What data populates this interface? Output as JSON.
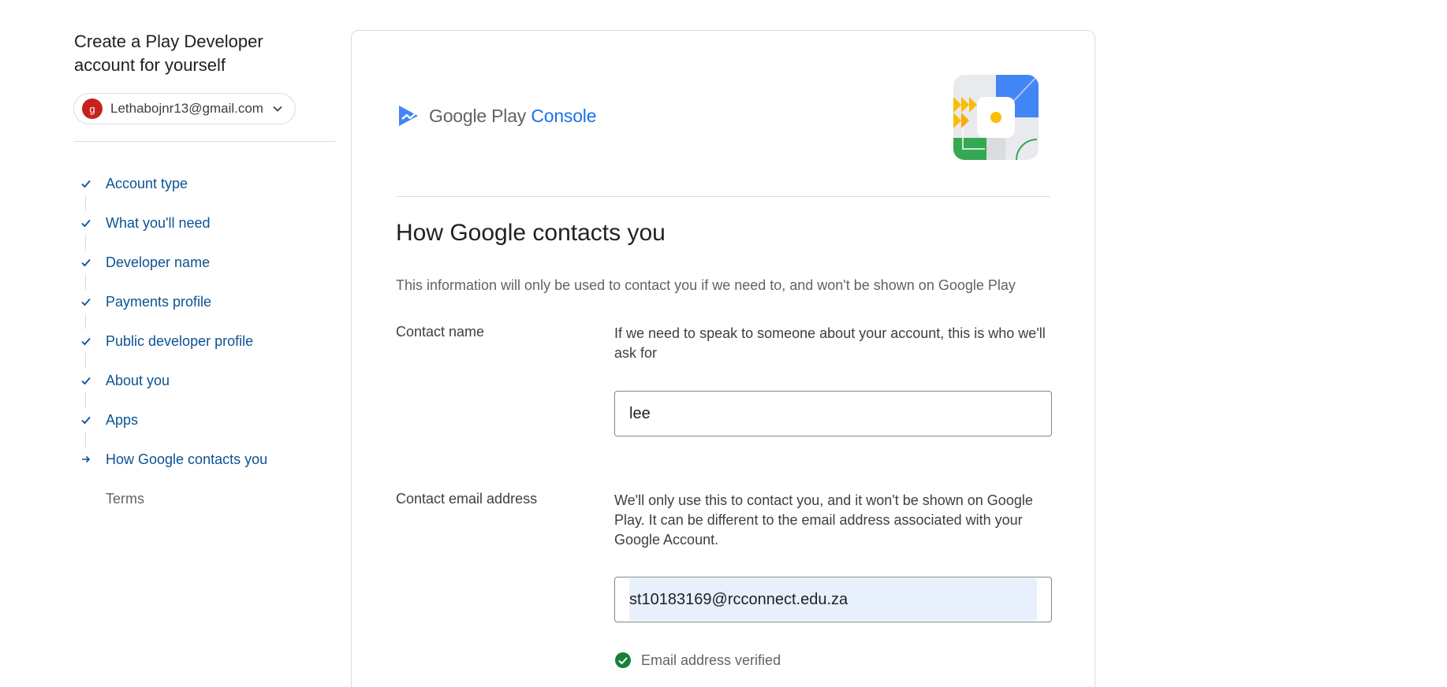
{
  "sidebar": {
    "heading": "Create a Play Developer account for yourself",
    "account": {
      "avatar_letter": "g",
      "email": "Lethabojnr13@gmail.com"
    },
    "steps": [
      {
        "label": "Account type",
        "status": "done"
      },
      {
        "label": "What you'll need",
        "status": "done"
      },
      {
        "label": "Developer name",
        "status": "done"
      },
      {
        "label": "Payments profile",
        "status": "done"
      },
      {
        "label": "Public developer profile",
        "status": "done"
      },
      {
        "label": "About you",
        "status": "done"
      },
      {
        "label": "Apps",
        "status": "done"
      },
      {
        "label": "How Google contacts you",
        "status": "current"
      },
      {
        "label": "Terms",
        "status": "upcoming"
      }
    ]
  },
  "main": {
    "brand": {
      "google_play": "Google Play",
      "console": "Console"
    },
    "title": "How Google contacts you",
    "description": "This information will only be used to contact you if we need to, and won't be shown on Google Play",
    "contact_name": {
      "label": "Contact name",
      "help": "If we need to speak to someone about your account, this is who we'll ask for",
      "value": "lee"
    },
    "contact_email": {
      "label": "Contact email address",
      "help": "We'll only use this to contact you, and it won't be shown on Google Play. It can be different to the email address associated with your Google Account.",
      "value": "st10183169@rcconnect.edu.za",
      "verified_text": "Email address verified"
    }
  },
  "colors": {
    "link": "#0b5394",
    "accent": "#1a73e8",
    "verified": "#188038",
    "avatar": "#c5221f"
  }
}
